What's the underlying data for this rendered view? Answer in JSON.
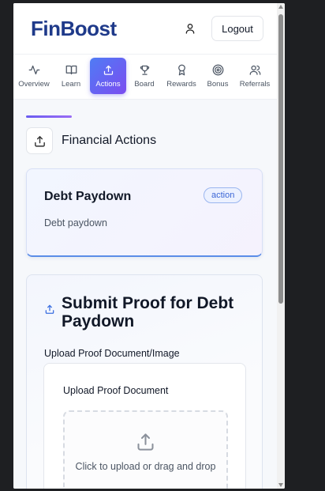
{
  "app": {
    "logo_text": "FinBoost",
    "brand_color": "#1f3a8a",
    "accent_gradient": [
      "#4f7cf5",
      "#7b4cf0"
    ]
  },
  "header": {
    "user_icon": "user-icon",
    "logout_label": "Logout"
  },
  "nav": {
    "items": [
      {
        "label": "Overview",
        "icon": "activity-icon",
        "active": false
      },
      {
        "label": "Learn",
        "icon": "book-icon",
        "active": false
      },
      {
        "label": "Actions",
        "icon": "upload-icon",
        "active": true
      },
      {
        "label": "Board",
        "icon": "trophy-icon",
        "active": false
      },
      {
        "label": "Rewards",
        "icon": "award-icon",
        "active": false
      },
      {
        "label": "Bonus",
        "icon": "target-icon",
        "active": false
      },
      {
        "label": "Referrals",
        "icon": "users-icon",
        "active": false
      }
    ]
  },
  "section": {
    "icon": "upload-icon",
    "title": "Financial Actions"
  },
  "action_card": {
    "title": "Debt Paydown",
    "description": "Debt paydown",
    "badge": "action"
  },
  "proof_card": {
    "icon": "upload-icon",
    "title": "Submit Proof for Debt Paydown",
    "upload_label": "Upload Proof Document/Image",
    "panel_title": "Upload Proof Document",
    "dropzone_icon": "upload-icon",
    "dropzone_text": "Click to upload or drag and drop"
  }
}
